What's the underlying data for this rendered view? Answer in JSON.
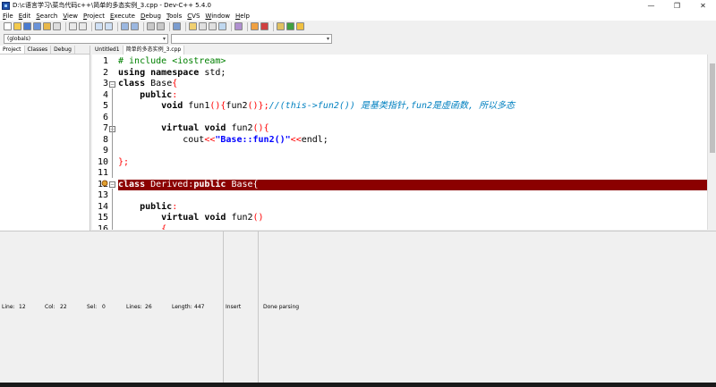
{
  "window": {
    "title": "D:\\c语言学习\\菜鸟代码c++\\简单的多态实例_3.cpp - Dev-C++ 5.4.0",
    "minimize": "—",
    "maximize": "❐",
    "close": "✕"
  },
  "menu": [
    {
      "u": "F",
      "rest": "ile"
    },
    {
      "u": "E",
      "rest": "dit"
    },
    {
      "u": "S",
      "rest": "earch"
    },
    {
      "u": "V",
      "rest": "iew"
    },
    {
      "u": "P",
      "rest": "roject"
    },
    {
      "u": "E",
      "rest": "xecute"
    },
    {
      "u": "D",
      "rest": "ebug"
    },
    {
      "u": "T",
      "rest": "ools"
    },
    {
      "u": "C",
      "rest": "VS"
    },
    {
      "u": "W",
      "rest": "indow"
    },
    {
      "u": "H",
      "rest": "elp"
    }
  ],
  "scope": {
    "combo1": "(globals)",
    "combo2": ""
  },
  "left_tabs": [
    "Project",
    "Classes",
    "Debug"
  ],
  "editor_tabs": [
    "Untitled1",
    "简单的多态实例_3.cpp"
  ],
  "line_numbers": [
    "1",
    "2",
    "3",
    "4",
    "5",
    "6",
    "7",
    "8",
    "9",
    "10",
    "11",
    "12",
    "13",
    "14",
    "15",
    "16"
  ],
  "code": {
    "l1a": "# include ",
    "l1b": "<iostream>",
    "l2a": "using namespace",
    "l2b": " std;",
    "l3a": "class",
    "l3b": " Base",
    "l3c": "{",
    "l4a": "    public",
    "l4b": ":",
    "l5a": "        void",
    "l5b": " fun1",
    "l5c": "(){",
    "l5d": "fun2",
    "l5e": "()};",
    "l5f": "//(this->fun2()) 是基类指针,fun2是虚函数, 所以多态",
    "l7a": "        virtual void",
    "l7b": " fun2",
    "l7c": "(){",
    "l8a": "            cout",
    "l8b": "<<",
    "l8c": "\"Base::fun2()\"",
    "l8d": "<<",
    "l8e": "endl;",
    "l10a": "}",
    "l10b": ";",
    "l12a": "class",
    "l12b": " Derived",
    "l12c": ":",
    "l12d": "public",
    "l12e": " Base",
    "l12f": "{",
    "l14a": "    public",
    "l14b": ":",
    "l15a": "        virtual void",
    "l15b": " fun2",
    "l15c": "()",
    "l16a": "        {"
  },
  "status": {
    "line_label": "Line:",
    "line_val": "12",
    "col_label": "Col:",
    "col_val": "22",
    "sel_label": "Sel:",
    "sel_val": "0",
    "lines_label": "Lines:",
    "lines_val": "26",
    "length_label": "Length:",
    "length_val": "447",
    "mode": "Insert",
    "message": "Done parsing"
  },
  "colors": {
    "highlight_line": "#8b0000",
    "keyword": "#000000",
    "symbol": "#ff0000",
    "comment": "#0080c0",
    "string": "#0000ff",
    "directive": "#008000"
  },
  "icons": [
    "app-icon",
    "bookmark-icon",
    "fold-icon"
  ]
}
